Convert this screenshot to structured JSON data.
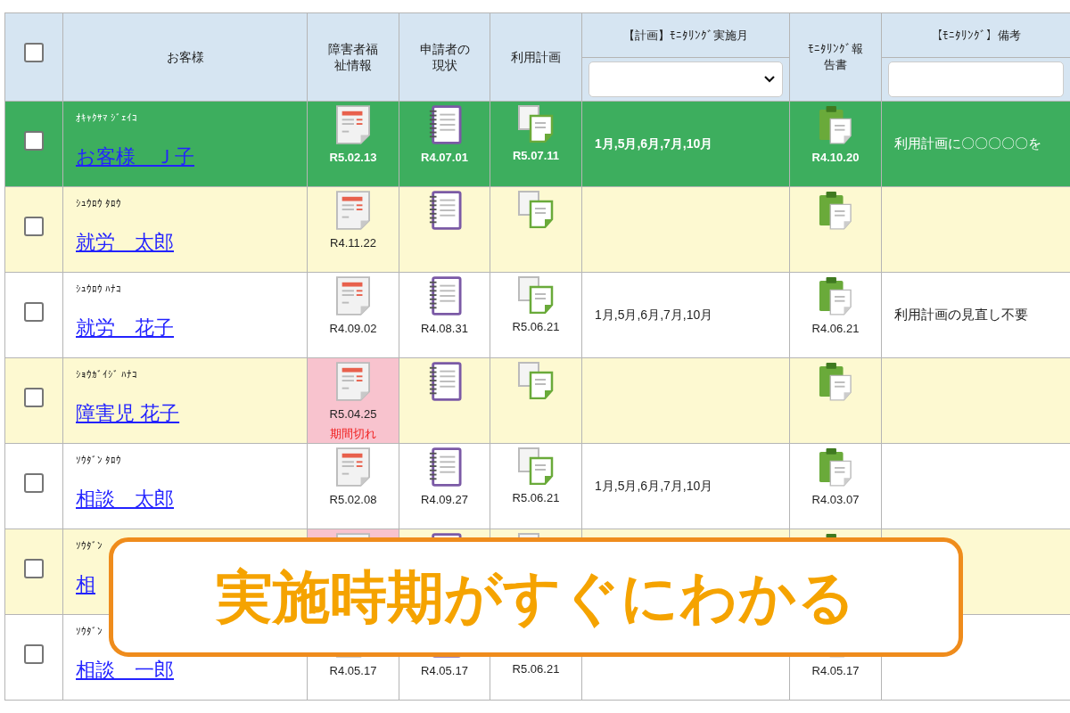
{
  "table": {
    "header_checkbox": {
      "checked": false
    },
    "columns": [
      {
        "kind": "text",
        "label": "お客様"
      },
      {
        "kind": "text",
        "label": "障害者福祉情報"
      },
      {
        "kind": "text",
        "label": "申請者の現状"
      },
      {
        "kind": "text",
        "label": "利用計画"
      },
      {
        "kind": "select",
        "label": "【計画】ﾓﾆﾀﾘﾝｸﾞ実施月"
      },
      {
        "kind": "text",
        "label": "ﾓﾆﾀﾘﾝｸﾞ報告書"
      },
      {
        "kind": "input",
        "label": "【ﾓﾆﾀﾘﾝｸﾞ】備考"
      }
    ],
    "rows": [
      {
        "selected": true,
        "checked": false,
        "kana": "ｵｷｬｸｻﾏ ｼﾞｪｲｺ",
        "name": "お客様　Ｊ子",
        "docs": [
          {
            "date": "R5.02.13",
            "expired": false
          },
          {
            "date": "R4.07.01",
            "expired": false
          },
          {
            "date": "R5.07.11",
            "expired": false
          }
        ],
        "months": "1月,5月,6月,7月,10月",
        "report": {
          "date": "R4.10.20"
        },
        "remarks": "利用計画に〇〇〇〇〇を"
      },
      {
        "selected": false,
        "shaded": true,
        "checked": false,
        "kana": "ｼｭｳﾛｳ ﾀﾛｳ",
        "name": "就労　太郎",
        "docs": [
          {
            "date": "R4.11.22",
            "expired": false
          },
          {
            "expired": false
          },
          {
            "expired": false
          }
        ],
        "report": {}
      },
      {
        "selected": false,
        "shaded": false,
        "checked": false,
        "kana": "ｼｭｳﾛｳ ﾊﾅｺ",
        "name": "就労　花子",
        "docs": [
          {
            "date": "R4.09.02",
            "expired": false
          },
          {
            "date": "R4.08.31",
            "expired": false
          },
          {
            "date": "R5.06.21",
            "expired": false
          }
        ],
        "months": "1月,5月,6月,7月,10月",
        "report": {
          "date": "R4.06.21"
        },
        "remarks": "利用計画の見直し不要"
      },
      {
        "selected": false,
        "shaded": true,
        "checked": false,
        "kana": "ｼｮｳｶﾞｲｼﾞ ﾊﾅｺ",
        "name": "障害児 花子",
        "docs": [
          {
            "date": "R5.04.25",
            "expired": true,
            "note": "期間切れ"
          },
          {
            "expired": false
          },
          {
            "expired": false
          }
        ],
        "report": {}
      },
      {
        "selected": false,
        "shaded": false,
        "checked": false,
        "kana": "ｿｳﾀﾞﾝ ﾀﾛｳ",
        "name": "相談　太郎",
        "docs": [
          {
            "date": "R5.02.08",
            "expired": false
          },
          {
            "date": "R4.09.27",
            "expired": false
          },
          {
            "date": "R5.06.21",
            "expired": false
          }
        ],
        "months": "1月,5月,6月,7月,10月",
        "report": {
          "date": "R4.03.07"
        }
      },
      {
        "selected": false,
        "shaded": true,
        "checked": false,
        "kana": "ｿｳﾀﾞﾝ",
        "name": "相",
        "docs": [
          {
            "expired": true
          },
          {
            "expired": false
          },
          {
            "expired": false
          }
        ],
        "report": {}
      },
      {
        "selected": false,
        "shaded": false,
        "checked": false,
        "kana": "ｿｳﾀﾞﾝ",
        "name": "相談　一郎",
        "docs": [
          {
            "date": "R4.05.17",
            "expired": false
          },
          {
            "date": "R4.05.17",
            "expired": false
          },
          {
            "date": "R5.06.21",
            "expired": false
          }
        ],
        "report": {
          "date": "R4.05.17"
        }
      }
    ]
  },
  "banner": {
    "text": "実施時期がすぐにわかる"
  }
}
